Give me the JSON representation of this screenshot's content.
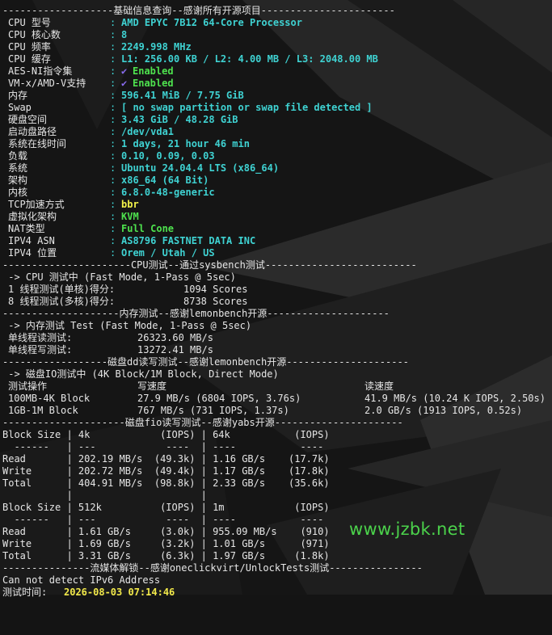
{
  "sections": {
    "basic": "-------------------基础信息查询--感谢所有开源项目-----------------------",
    "cpu_test": "----------------------CPU测试--通过sysbench测试--------------------------",
    "mem_test": "--------------------内存测试--感谢lemonbench开源---------------------",
    "disk_dd": "------------------磁盘dd读写测试--感谢lemonbench开源---------------------",
    "disk_fio": "---------------------磁盘fio读写测试--感谢yabs开源----------------------",
    "stream": "---------------流媒体解锁--感谢oneclickvirt/UnlockTests测试----------------"
  },
  "basic_info": [
    {
      "label": "CPU 型号",
      "value": "AMD EPYC 7B12 64-Core Processor"
    },
    {
      "label": "CPU 核心数",
      "value": "8"
    },
    {
      "label": "CPU 频率",
      "value": "2249.998 MHz"
    },
    {
      "label": "CPU 缓存",
      "value": "L1: 256.00 KB / L2: 4.00 MB / L3: 2048.00 MB"
    },
    {
      "label": "AES-NI指令集",
      "check": "✔",
      "value": "Enabled"
    },
    {
      "label": "VM-x/AMD-V支持",
      "check": "✔",
      "value": "Enabled"
    },
    {
      "label": "内存",
      "value": "596.41 MiB / 7.75 GiB"
    },
    {
      "label": "Swap",
      "value": "[ no swap partition or swap file detected ]"
    },
    {
      "label": "硬盘空间",
      "value": "3.43 GiB / 48.28 GiB"
    },
    {
      "label": "启动盘路径",
      "value": "/dev/vda1"
    },
    {
      "label": "系统在线时间",
      "value": "1 days, 21 hour 46 min"
    },
    {
      "label": "负载",
      "value": "0.10, 0.09, 0.03"
    },
    {
      "label": "系统",
      "value": "Ubuntu 24.04.4 LTS (x86_64)"
    },
    {
      "label": "架构",
      "value": "x86_64 (64 Bit)"
    },
    {
      "label": "内核",
      "value": "6.8.0-48-generic"
    },
    {
      "label": "TCP加速方式",
      "value": "bbr"
    },
    {
      "label": "虚拟化架构",
      "value": "KVM"
    },
    {
      "label": "NAT类型",
      "value": "Full Cone"
    },
    {
      "label": "IPV4 ASN",
      "value": "AS8796 FASTNET DATA INC"
    },
    {
      "label": "IPV4 位置",
      "value": "Orem / Utah / US"
    }
  ],
  "cpu": {
    "mode": " -> CPU 测试中 (Fast Mode, 1-Pass @ 5sec)",
    "single_label": "1 线程测试(单核)得分:",
    "single_score": "1094 Scores",
    "multi_label": "8 线程测试(多核)得分:",
    "multi_score": "8738 Scores"
  },
  "mem": {
    "mode": " -> 内存测试 Test (Fast Mode, 1-Pass @ 5sec)",
    "read_label": "单线程读测试:",
    "read_value": "26323.60 MB/s",
    "write_label": "单线程写测试:",
    "write_value": "13272.41 MB/s"
  },
  "dd": {
    "mode": " -> 磁盘IO测试中 (4K Block/1M Block, Direct Mode)",
    "headers": {
      "op": "测试操作",
      "write": "写速度",
      "read": "读速度"
    },
    "rows": [
      {
        "op": "100MB-4K Block",
        "write": "27.9 MB/s (6804 IOPS, 3.76s)",
        "read": "41.9 MB/s (10.24 K IOPS, 2.50s)"
      },
      {
        "op": "1GB-1M Block",
        "write": "767 MB/s (731 IOPS, 1.37s)",
        "read": "2.0 GB/s (1913 IOPS, 0.52s)"
      }
    ]
  },
  "fio_lines": [
    "Block Size | 4k            (IOPS) | 64k           (IOPS)",
    "  ------   | ---            ----  | ----           ----",
    "Read       | 202.19 MB/s  (49.3k) | 1.16 GB/s    (17.7k)",
    "Write      | 202.72 MB/s  (49.4k) | 1.17 GB/s    (17.8k)",
    "Total      | 404.91 MB/s  (98.8k) | 2.33 GB/s    (35.6k)",
    "           |                      |",
    "Block Size | 512k          (IOPS) | 1m            (IOPS)",
    "  ------   | ---            ----  | ----           ----",
    "Read       | 1.61 GB/s     (3.0k) | 955.09 MB/s    (910)",
    "Write      | 1.69 GB/s     (3.2k) | 1.01 GB/s      (971)",
    "Total      | 3.31 GB/s     (6.3k) | 1.97 GB/s     (1.8k)"
  ],
  "stream": {
    "ipv6": "Can not detect IPv6 Address",
    "time_label": "测试时间: ",
    "time_value": "2026-08-03 07:14:46"
  },
  "watermark": "www.jzbk.net",
  "colors": {
    "cyan": "#3fd2d2",
    "green": "#4ee24e",
    "yellow": "#f2f24a",
    "check": "#8a6cf0"
  }
}
